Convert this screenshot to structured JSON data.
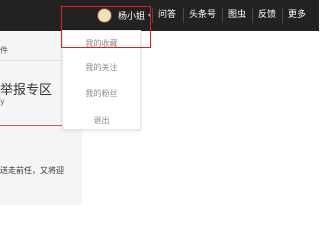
{
  "topbar": {
    "user_name": "杨小姐",
    "nav": [
      "问答",
      "头条号",
      "图虫",
      "反馈",
      "更多"
    ]
  },
  "dropdown": {
    "items": [
      "我的收藏",
      "我的关注",
      "我的粉丝",
      "退出"
    ]
  },
  "left": {
    "crumb": "件",
    "report_title": "举报专区",
    "report_sub": "y",
    "snippet": "送走前任，又将迎"
  },
  "colors": {
    "topbar_bg": "#222222",
    "highlight_border": "#e02020",
    "accent_red": "#d9534f"
  },
  "icons": [
    "avatar",
    "chevron-down-icon"
  ]
}
